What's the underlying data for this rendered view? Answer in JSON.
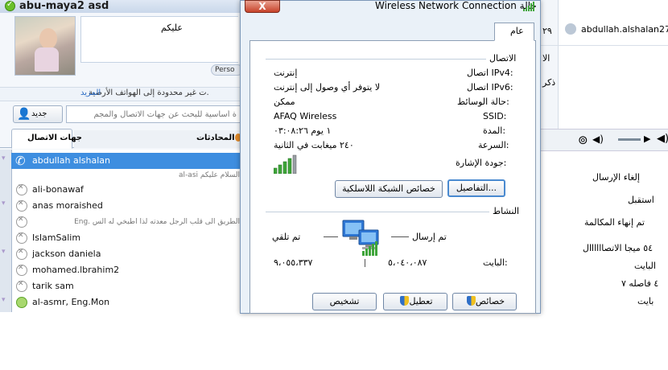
{
  "left_window": {
    "title": "abu-maya2 asd",
    "mood_text": "عليكم",
    "personalize_button": "Perso",
    "landline_notice": "ت غير محدودة إلى الهواتف الأرضية.",
    "landline_more_link": "المزيد",
    "new_button": "جديد",
    "search_placeholder": "ة أساسية للبحث عن جهات الاتصال والمجم",
    "tabs": {
      "contacts": "جهات الاتصال",
      "conversations": "المحادثات"
    },
    "contacts": [
      {
        "name": "abdullah alshalan",
        "mood": "",
        "selected": true
      },
      {
        "name": "",
        "mood": "al-asi السلام عليكم",
        "selected": false
      },
      {
        "name": "ali-bonawaf",
        "mood": "",
        "selected": false
      },
      {
        "name": "anas moraished",
        "mood": "",
        "selected": false
      },
      {
        "name": "",
        "mood": "Eng. الطريق الى قلب الرجل معدته لذا اطبخي له الس",
        "selected": false
      },
      {
        "name": "IslamSalim",
        "mood": "",
        "selected": false
      },
      {
        "name": "jackson daniela",
        "mood": "",
        "selected": false
      },
      {
        "name": "mohamed.lbrahim2",
        "mood": "",
        "selected": false
      },
      {
        "name": "tarik sam",
        "mood": "",
        "selected": false
      },
      {
        "name": "al-asmr, Eng.Mon",
        "mood": "",
        "selected": false,
        "group": true
      }
    ]
  },
  "dialog": {
    "title": "حالة Wireless Network Connection",
    "close": "X",
    "tab_general": "عام",
    "connection": {
      "heading": "الاتصال",
      "rows": [
        {
          "label": "اتصال IPv4:",
          "value": "إنترنت"
        },
        {
          "label": "اتصال IPv6:",
          "value": "لا يتوفر أي وصول إلى إنترنت"
        },
        {
          "label": "حالة الوسائط:",
          "value": "ممكن"
        },
        {
          "label": "SSID:",
          "value": "AFAQ Wireless"
        },
        {
          "label": "المدة:",
          "value": "١ يوم ٠٣:٠٨:٢٦"
        },
        {
          "label": "السرعة:",
          "value": "٢٤٠ ميغابت في الثانية"
        }
      ],
      "signal_label": "جودة الإشارة:",
      "signal_bars": 5,
      "details_button": "التفاصيل...",
      "wireless_props_button": "خصائص الشبكة اللاسلكية"
    },
    "activity": {
      "heading": "النشاط",
      "sent_label": "تم إرسال",
      "received_label": "تم تلقي",
      "bytes_label": "البايت:",
      "sent_value": "٥،٠٤٠،٠٨٧",
      "received_value": "٩،٠٥٥،٣٣٧"
    },
    "buttons": {
      "properties": "خصائص",
      "disable": "تعطيل",
      "diagnose": "تشخيص"
    }
  },
  "right_window": {
    "contact_name": "abdullah.alshalan27",
    "side_digits": [
      "٢٩",
      "الا",
      "ذكر"
    ],
    "items": [
      "إلغاء الإرسال",
      "استقبل",
      "تم إنهاء المكالمة",
      "٥٤ ميجا الاتصاااااال",
      "البايت",
      "٤ فاصله ٧",
      "بايت"
    ]
  },
  "colors": {
    "selection": "#3e8ee0",
    "online": "#6ac02b",
    "signal": "#3fa53a"
  }
}
